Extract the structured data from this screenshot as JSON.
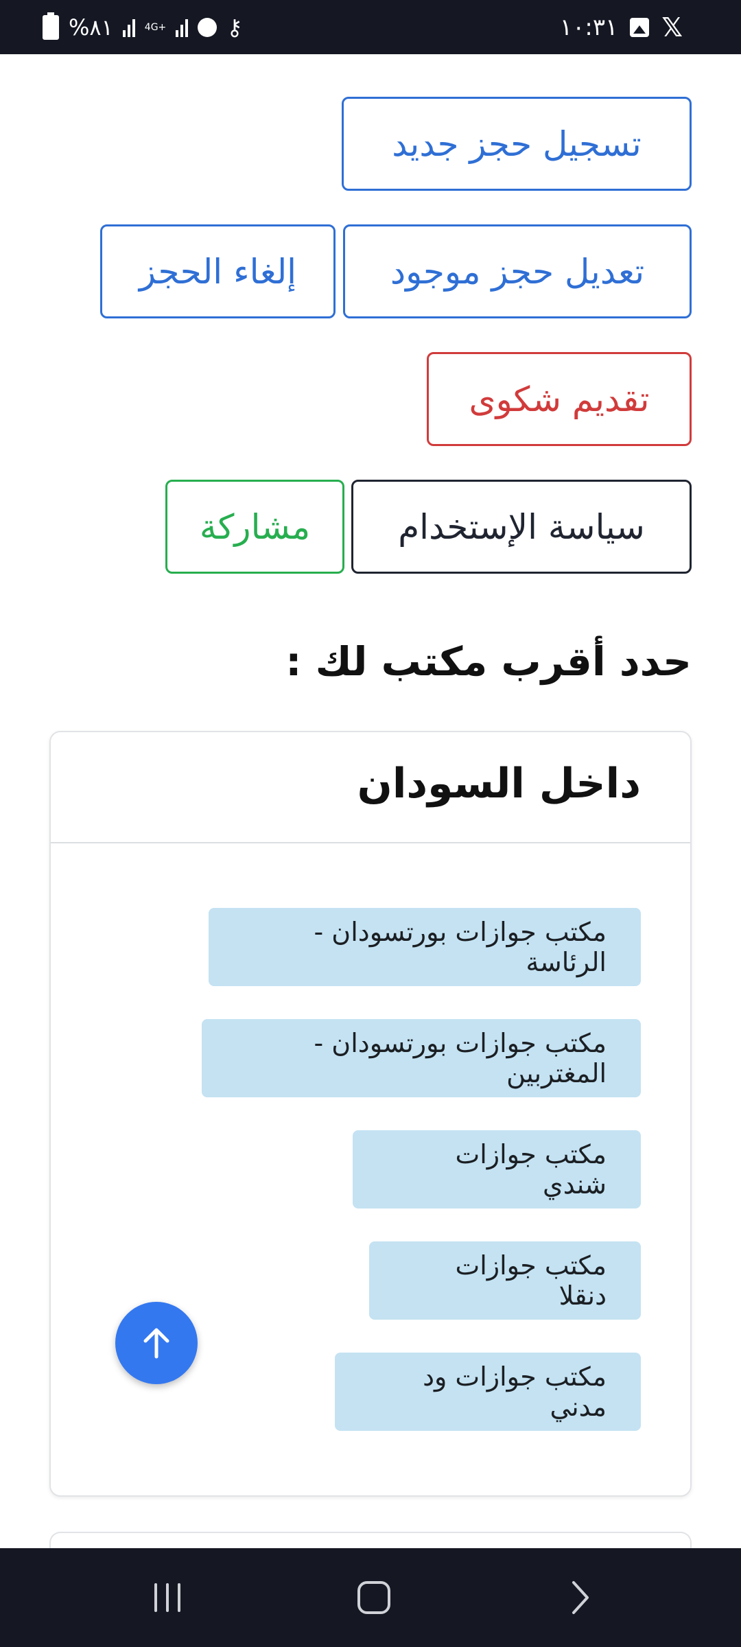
{
  "status_bar": {
    "time": "١٠:٣١",
    "battery": "%٨١",
    "network": "4G+",
    "icons": [
      "x-logo-icon",
      "image-icon",
      "battery-icon",
      "signal-icon",
      "alarm-icon",
      "vpn-key-icon"
    ]
  },
  "actions": {
    "new_booking": "تسجيل حجز جديد",
    "edit_booking": "تعديل حجز موجود",
    "cancel_booking": "إلغاء الحجز",
    "complaint": "تقديم شكوى",
    "usage_policy": "سياسة الإستخدام",
    "share": "مشاركة"
  },
  "colors": {
    "primary": "#2f6fd5",
    "danger": "#d13b3b",
    "dark": "#1f2430",
    "success": "#27ae4f",
    "office_bg": "#c4e2f2",
    "fab": "#3478f0"
  },
  "section": {
    "title": "حدد أقرب مكتب لك :"
  },
  "inside_sudan": {
    "title": "داخل السودان",
    "offices": [
      "مكتب جوازات بورتسودان - الرئاسة",
      "مكتب جوازات بورتسودان - المغتربين",
      "مكتب جوازات شندي",
      "مكتب جوازات دنقلا",
      "مكتب جوازات ود مدني"
    ]
  },
  "fab": {
    "icon": "arrow-up-icon"
  },
  "nav_bar": {
    "icons": [
      "recent-apps-icon",
      "home-icon",
      "back-icon"
    ]
  }
}
